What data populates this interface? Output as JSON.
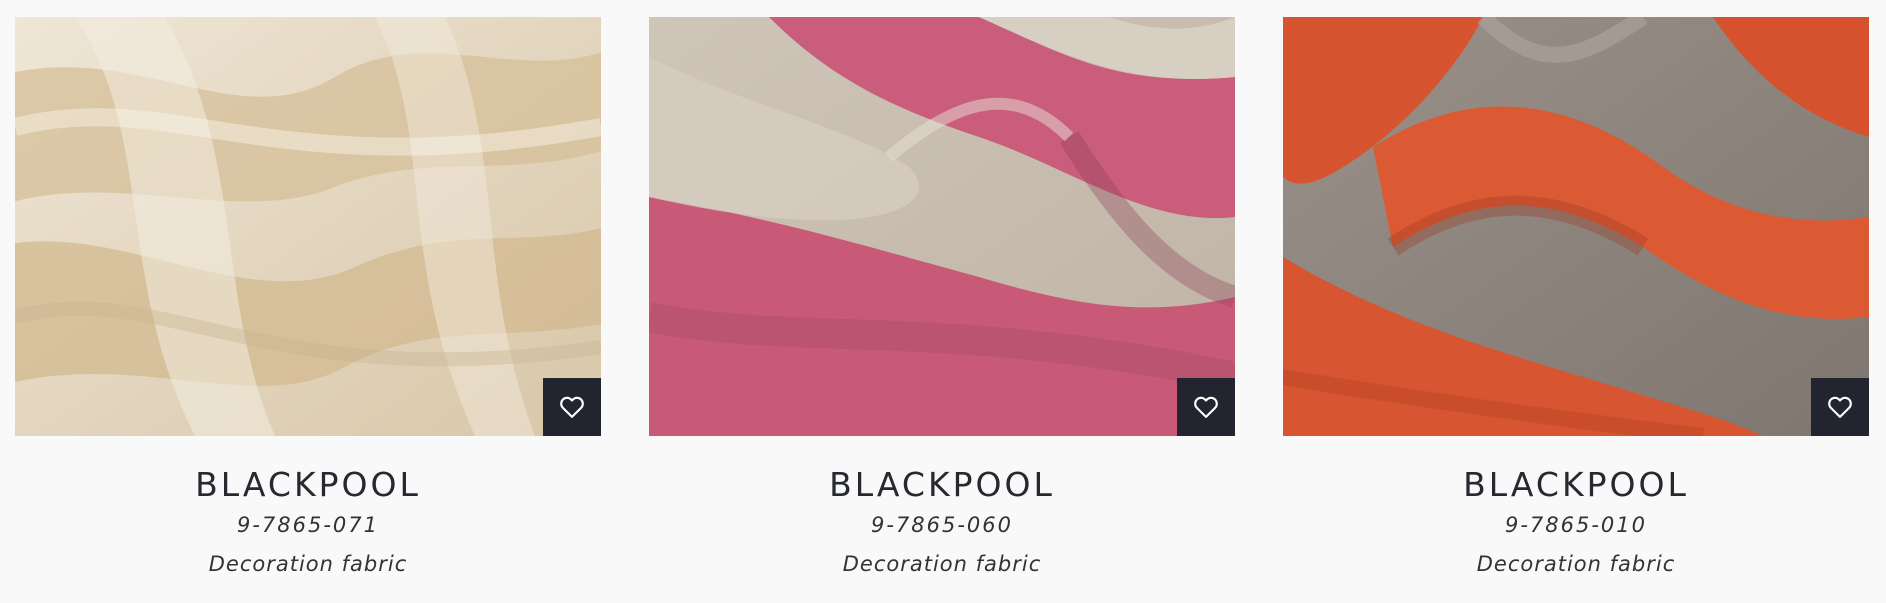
{
  "products": [
    {
      "name": "BLACKPOOL",
      "code": "9-7865-071",
      "type": "Decoration fabric",
      "favorite_icon": "heart-outline-icon",
      "colors": {
        "base": "#e6dcc9",
        "stripe": "#d4bc96",
        "shade": "#b9a583"
      }
    },
    {
      "name": "BLACKPOOL",
      "code": "9-7865-060",
      "type": "Decoration fabric",
      "favorite_icon": "heart-outline-icon",
      "colors": {
        "base": "#c9bfb2",
        "stripe": "#c85d7a",
        "shade": "#8f4358"
      }
    },
    {
      "name": "BLACKPOOL",
      "code": "9-7865-010",
      "type": "Decoration fabric",
      "favorite_icon": "heart-outline-icon",
      "colors": {
        "base": "#8a8179",
        "stripe": "#d6532f",
        "shade": "#8d3520"
      }
    }
  ],
  "favorite_button_color": "#22252f",
  "text_color": "#262a30"
}
